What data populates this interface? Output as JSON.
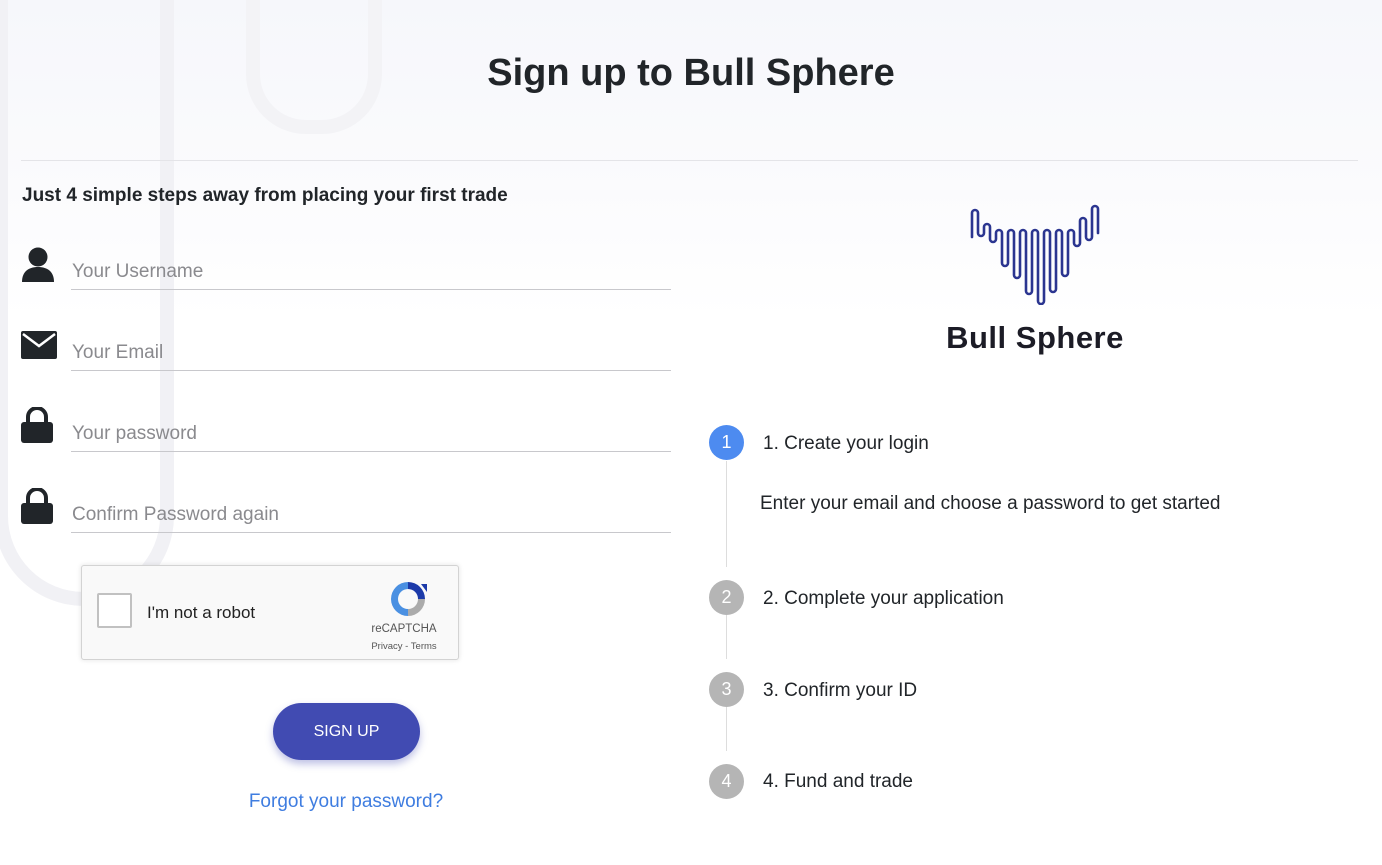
{
  "page": {
    "title": "Sign up to Bull Sphere",
    "subtitle": "Just 4 simple steps away from placing your first trade"
  },
  "form": {
    "username": {
      "placeholder": "Your Username",
      "value": "",
      "icon": "user-icon"
    },
    "email": {
      "placeholder": "Your Email",
      "value": "",
      "icon": "envelope-icon"
    },
    "password": {
      "placeholder": "Your password",
      "value": "",
      "icon": "lock-icon"
    },
    "confirm_password": {
      "placeholder": "Confirm Password again",
      "value": "",
      "icon": "lock-icon"
    }
  },
  "captcha": {
    "label": "I'm not a robot",
    "brand": "reCAPTCHA",
    "privacy": "Privacy",
    "separator": " - ",
    "terms": "Terms",
    "checked": false
  },
  "actions": {
    "signup_label": "SIGN UP",
    "forgot_label": "Forgot your password?"
  },
  "logo": {
    "name": "Bull Sphere"
  },
  "steps": [
    {
      "number": "1",
      "label": "1. Create your login",
      "active": true,
      "description": "Enter your email and choose a password to get started"
    },
    {
      "number": "2",
      "label": "2. Complete your application",
      "active": false
    },
    {
      "number": "3",
      "label": "3. Confirm your ID",
      "active": false
    },
    {
      "number": "4",
      "label": "4. Fund and trade",
      "active": false
    }
  ],
  "colors": {
    "accent": "#414bb2",
    "step_active": "#4d8bf0",
    "step_idle": "#b5b5b5",
    "link": "#3f7de0",
    "logo_mark": "#2b3590"
  }
}
